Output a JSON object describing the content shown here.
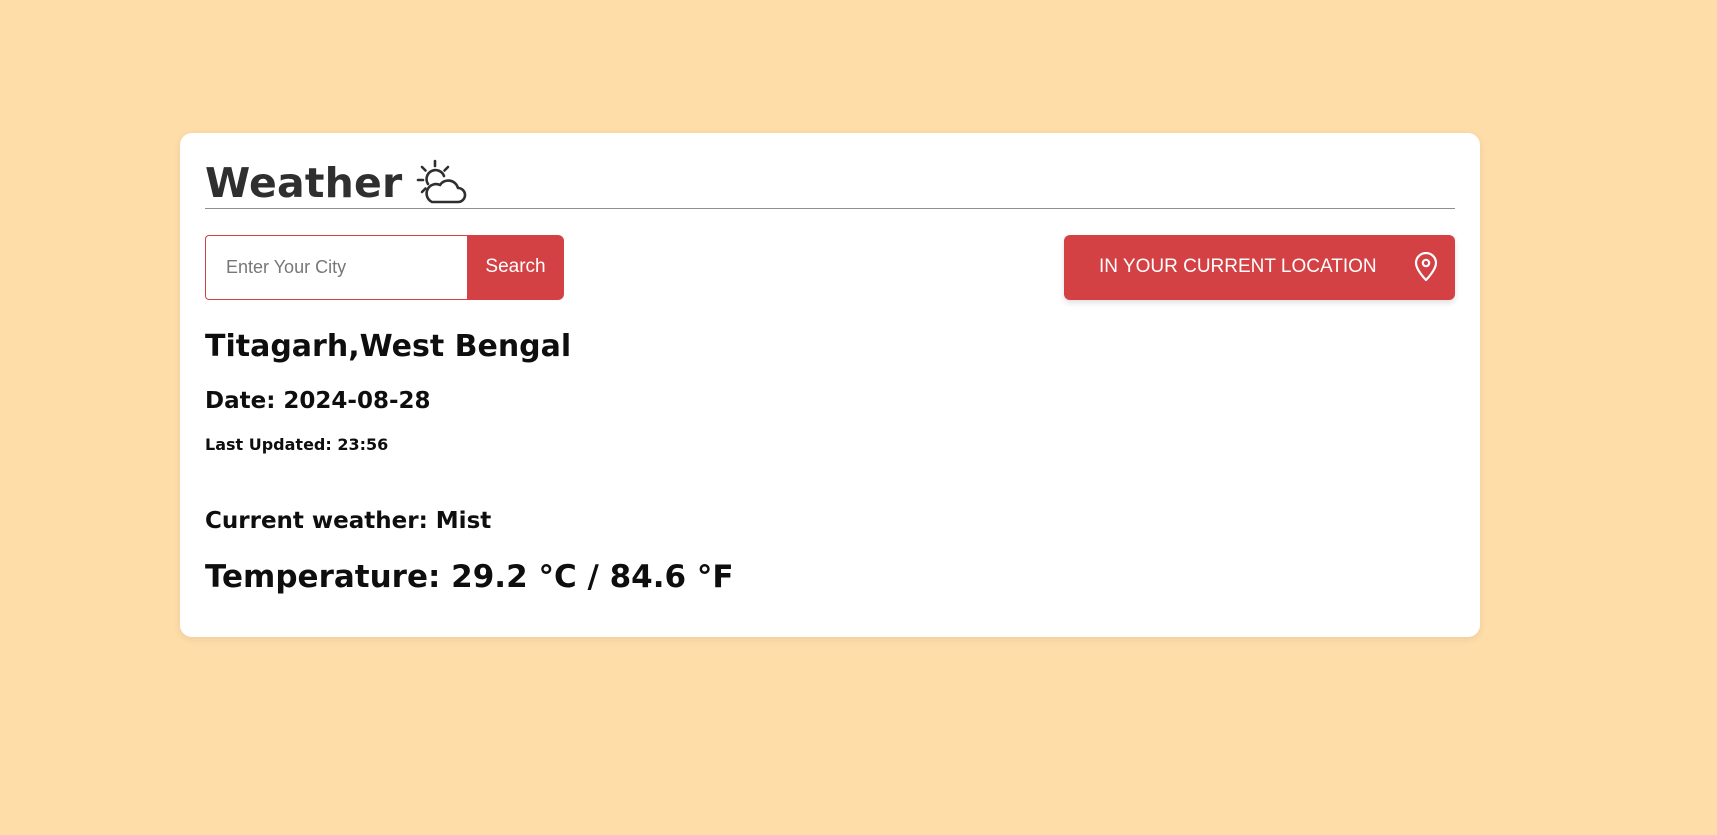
{
  "header": {
    "title": "Weather",
    "icon": "partly-cloudy-icon"
  },
  "search": {
    "placeholder": "Enter Your City",
    "value": "",
    "button_label": "Search"
  },
  "location_button": {
    "label": "IN YOUR CURRENT LOCATION",
    "icon": "location-pin-icon"
  },
  "weather": {
    "city": "Titagarh,West Bengal",
    "date": "Date: 2024-08-28",
    "last_updated": "Last Updated: 23:56",
    "condition": "Current weather: Mist",
    "temperature": "Temperature: 29.2 °C / 84.6 °F"
  },
  "colors": {
    "background": "#fedda9",
    "accent": "#d44144",
    "card": "#ffffff",
    "title_text": "#2f2f2f"
  }
}
